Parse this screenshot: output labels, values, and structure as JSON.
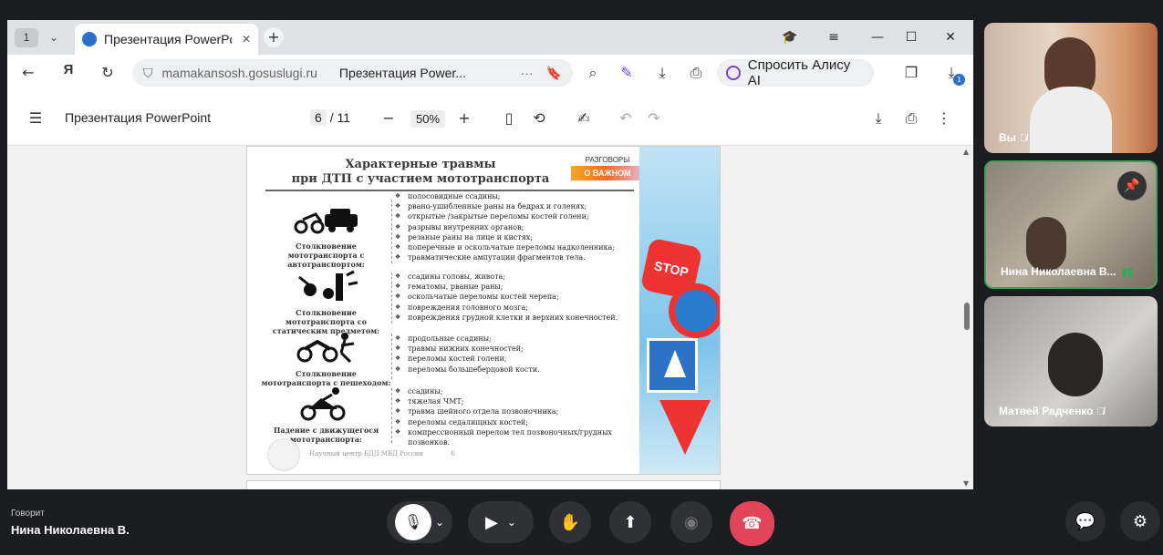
{
  "browser": {
    "tab_count": "1",
    "tab_title": "Презентация PowerPoint",
    "url_domain": "mamakansosh.gosuslugi.ru",
    "page_title": "Презентация Power...",
    "alice_label": "Спросить Алису AI",
    "downloads_badge": "1"
  },
  "pdf": {
    "doc_title": "Презентация PowerPoint",
    "current_page": "6",
    "total_pages": "/ 11",
    "zoom": "50%"
  },
  "slide": {
    "title_line1": "Характерные травмы",
    "title_line2": "при ДТП с участием мототранспорта",
    "badge_top": "РАЗГОВОРЫ",
    "badge_bottom": "О ВАЖНОМ",
    "stop_text": "STOP",
    "footer": "Научный центр БДД МВД России",
    "footer_page": "6",
    "sections": [
      {
        "label": "Столкновение мототранспорта с автотранспортом:",
        "items": [
          "полосовидные ссадины;",
          "рвано-ушибленные раны на бедрах и голенях;",
          "открытые /закрытые переломы костей голени;",
          "разрывы внутренних органов;",
          "резаные раны на лице и кистях;",
          "поперечные и оскольчатые переломы надколенника;",
          "травматические ампутации фрагментов тела."
        ]
      },
      {
        "label": "Столкновение мототранспорта со статическим предметом:",
        "items": [
          "ссадины головы, живота;",
          "гематомы, рваные раны;",
          "оскольчатые переломы костей черепа;",
          "повреждения головного мозга;",
          "повреждения грудной клетки и верхних конечностей."
        ]
      },
      {
        "label": "Столкновение мототранспорта с пешеходом:",
        "items": [
          "продольные ссадины;",
          "травмы нижних конечностей;",
          "переломы костей голени;",
          "переломы большеберцовой кости."
        ]
      },
      {
        "label": "Падение с движущегося мототранспорта:",
        "items": [
          "ссадины;",
          "тяжелая ЧМТ;",
          "травма шейного отдела позвоночника;",
          "переломы седалищных костей;",
          "компрессионный перелом тел позвоночных/грудных позвонков."
        ]
      }
    ]
  },
  "participants": [
    {
      "name": "Вы"
    },
    {
      "name": "Нина Николаевна В..."
    },
    {
      "name": "Матвей Радченко"
    }
  ],
  "call": {
    "speaking_label": "Говорит",
    "speaker_name": "Нина Николаевна В."
  }
}
